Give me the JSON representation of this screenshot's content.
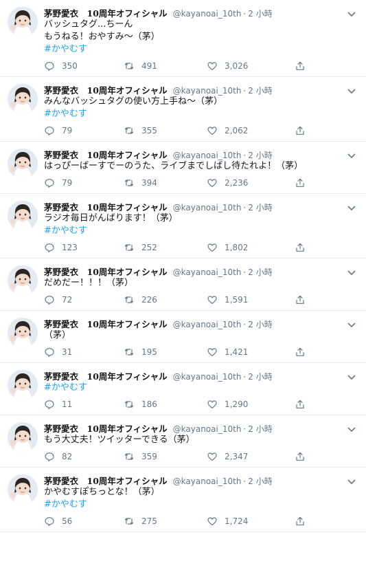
{
  "author": {
    "name": "茅野愛衣　10周年オフィシャル",
    "handle": "@kayanoai_10th",
    "separator": "·",
    "time": "2 小時"
  },
  "colors": {
    "accent": "#1da1f2",
    "muted": "#657786",
    "divider": "#e6ecf0"
  },
  "icons": {
    "reply": "reply-icon",
    "retweet": "retweet-icon",
    "like": "heart-icon",
    "share": "share-icon",
    "menu": "chevron-down-icon"
  },
  "tweets": [
    {
      "lines": [
        "バッシュタグ...ちーん",
        "もうねる！おやすみ～（茅）"
      ],
      "hashtag": "#かやむす",
      "replies": "350",
      "retweets": "491",
      "likes": "3,026"
    },
    {
      "lines": [
        "みんなバッシュタグの使い方上手ね～（茅）"
      ],
      "hashtag": "#かやむす",
      "replies": "79",
      "retweets": "355",
      "likes": "2,062"
    },
    {
      "lines": [
        "はっぴーばーすでーのうた、ライブまでしばし待たれよ！（茅）"
      ],
      "hashtag": "",
      "replies": "79",
      "retweets": "394",
      "likes": "2,236"
    },
    {
      "lines": [
        "ラジオ毎日がんばります！（茅）"
      ],
      "hashtag": "#かやむす",
      "replies": "123",
      "retweets": "252",
      "likes": "1,802"
    },
    {
      "lines": [
        "だめだー！！！（茅）"
      ],
      "hashtag": "",
      "replies": "72",
      "retweets": "226",
      "likes": "1,591"
    },
    {
      "lines": [
        "（茅）"
      ],
      "hashtag": "",
      "replies": "31",
      "retweets": "195",
      "likes": "1,421"
    },
    {
      "lines": [],
      "hashtag": "#かやむす",
      "replies": "11",
      "retweets": "186",
      "likes": "1,290"
    },
    {
      "lines": [
        "もう大丈夫！ツイッターできる（茅）"
      ],
      "hashtag": "",
      "replies": "82",
      "retweets": "359",
      "likes": "2,347"
    },
    {
      "lines": [
        "かやむすぽちっとな！（茅）"
      ],
      "hashtag": "#かやむす",
      "replies": "56",
      "retweets": "275",
      "likes": "1,724"
    }
  ]
}
